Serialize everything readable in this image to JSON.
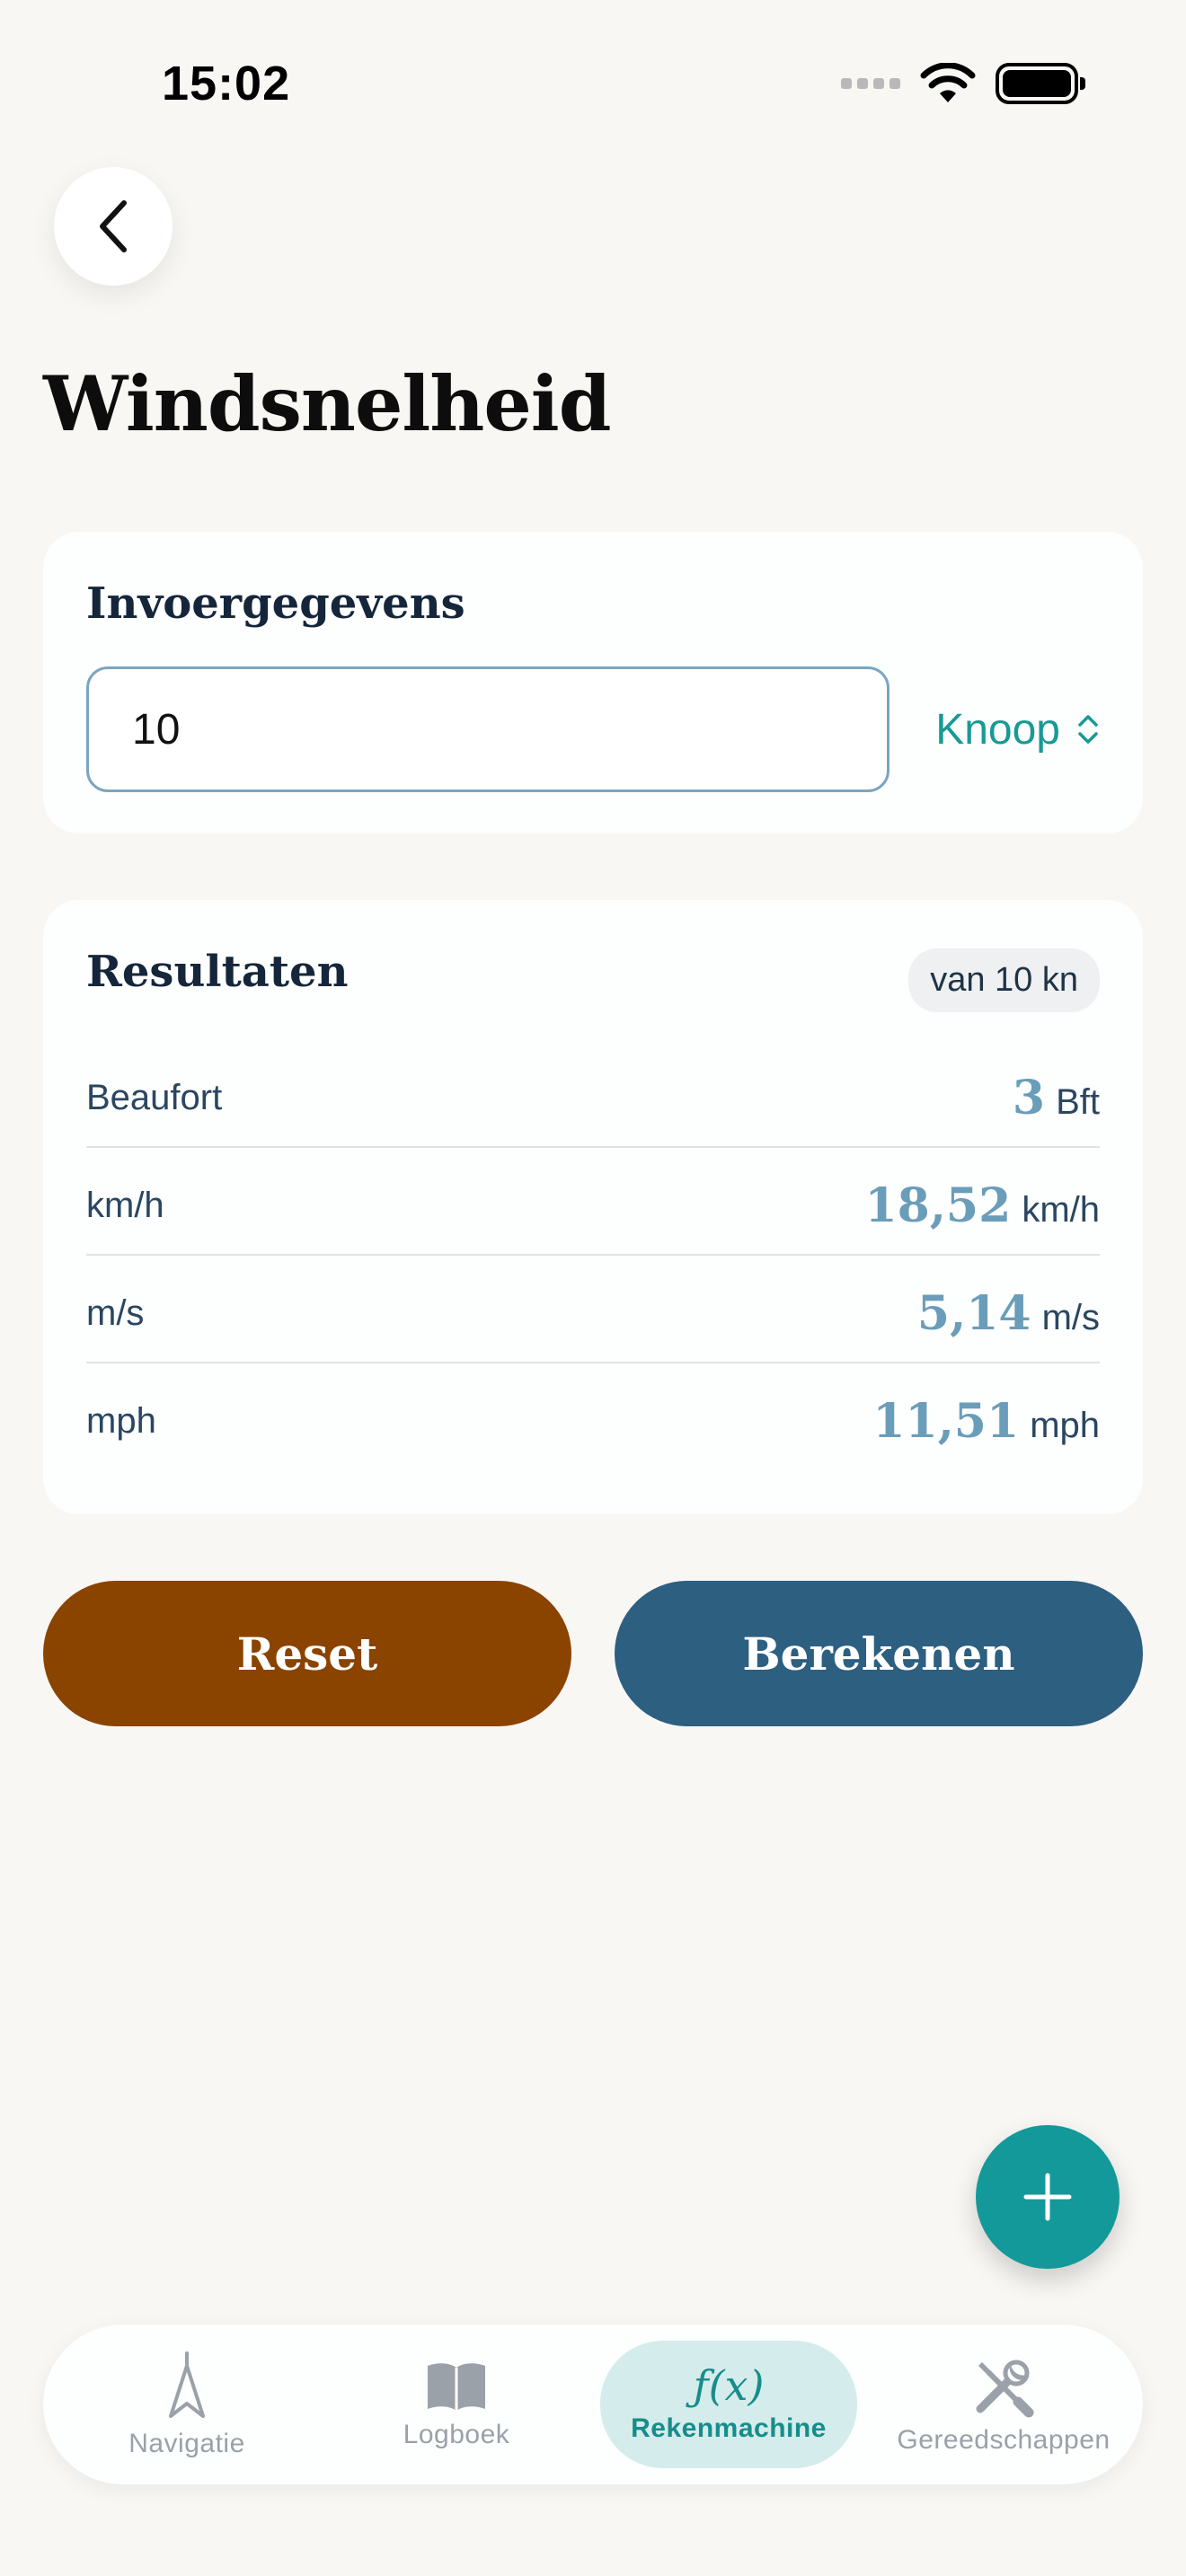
{
  "status_bar": {
    "time": "15:02"
  },
  "header": {
    "title": "Windsnelheid"
  },
  "input_card": {
    "title": "Invoergegevens",
    "value": "10",
    "unit": "Knoop"
  },
  "results_card": {
    "title": "Resultaten",
    "badge": "van 10 kn",
    "rows": [
      {
        "label": "Beaufort",
        "value": "3",
        "unit": "Bft"
      },
      {
        "label": "km/h",
        "value": "18,52",
        "unit": "km/h"
      },
      {
        "label": "m/s",
        "value": "5,14",
        "unit": "m/s"
      },
      {
        "label": "mph",
        "value": "11,51",
        "unit": "mph"
      }
    ]
  },
  "actions": {
    "reset_label": "Reset",
    "calculate_label": "Berekenen"
  },
  "tabbar": {
    "tabs": [
      {
        "label": "Navigatie",
        "icon": "navigation-arrow-icon",
        "active": false
      },
      {
        "label": "Logboek",
        "icon": "book-icon",
        "active": false
      },
      {
        "label": "Rekenmachine",
        "icon": "function-icon",
        "active": true,
        "glyph": "ƒ(x)"
      },
      {
        "label": "Gereedschappen",
        "icon": "tools-icon",
        "active": false
      }
    ]
  },
  "colors": {
    "accent": "#14999a",
    "reset": "#8b4300",
    "calculate": "#2c5f80",
    "result_value": "#6a9db9",
    "background": "#f9f7f4"
  }
}
